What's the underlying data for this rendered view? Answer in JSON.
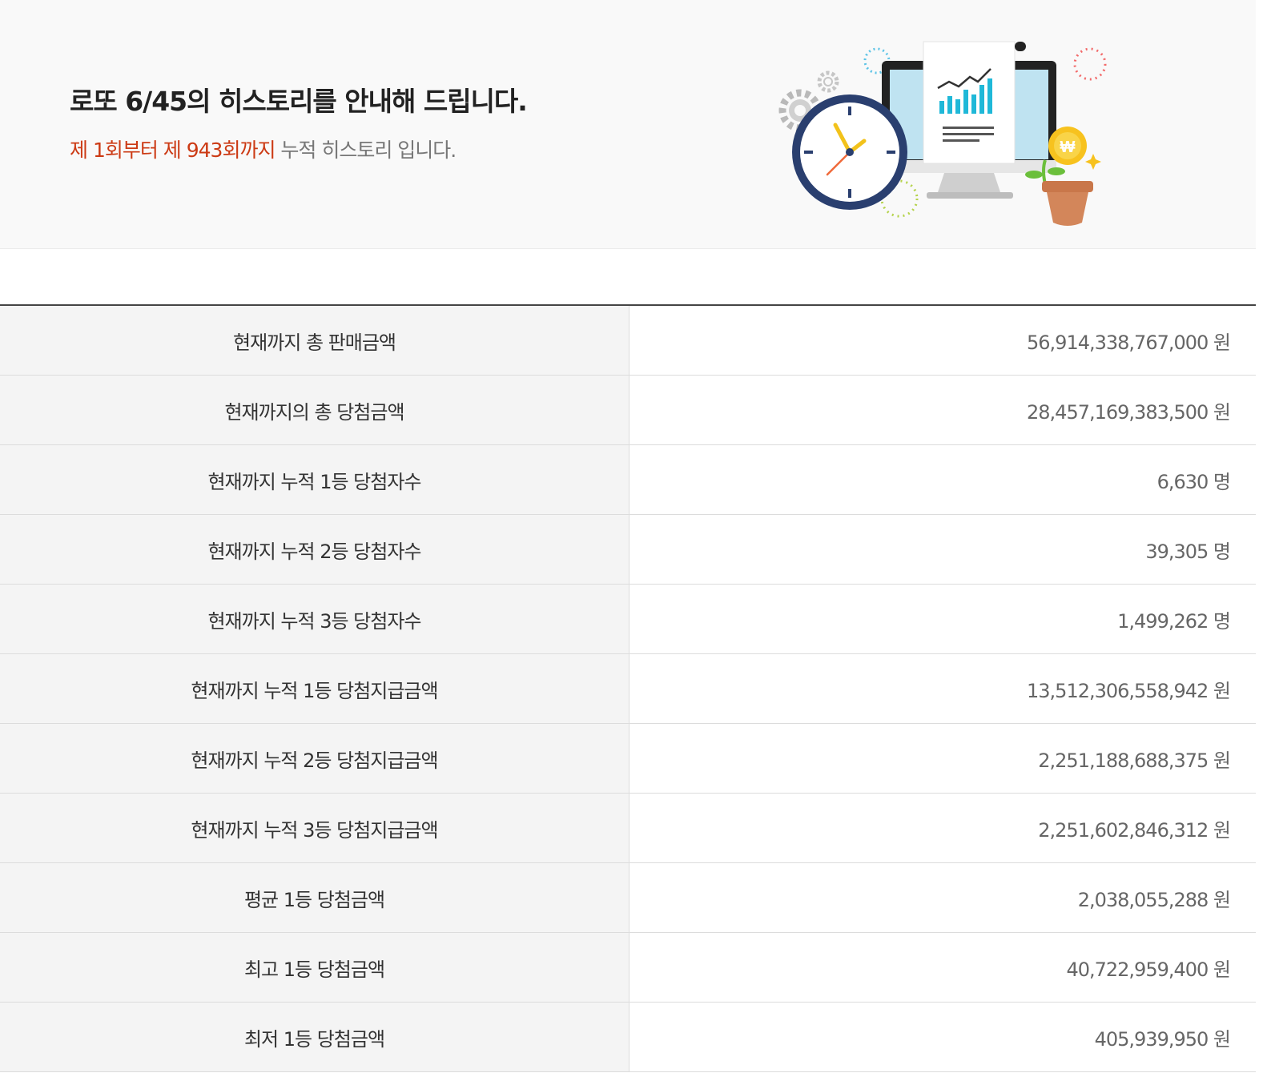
{
  "header": {
    "title": "로또 6/45의 히스토리를 안내해 드립니다.",
    "subtitle_highlight": "제 1회부터 제 943회까지",
    "subtitle_rest": " 누적 히스토리 입니다."
  },
  "illustration": {
    "icon": "lotto-history-illustration",
    "coin_symbol": "₩"
  },
  "stats": [
    {
      "label": "현재까지 총 판매금액",
      "value": "56,914,338,767,000 원"
    },
    {
      "label": "현재까지의 총 당첨금액",
      "value": "28,457,169,383,500 원"
    },
    {
      "label": "현재까지 누적 1등 당첨자수",
      "value": "6,630 명"
    },
    {
      "label": "현재까지 누적 2등 당첨자수",
      "value": "39,305 명"
    },
    {
      "label": "현재까지 누적 3등 당첨자수",
      "value": "1,499,262 명"
    },
    {
      "label": "현재까지 누적 1등 당첨지급금액",
      "value": "13,512,306,558,942 원"
    },
    {
      "label": "현재까지 누적 2등 당첨지급금액",
      "value": "2,251,188,688,375 원"
    },
    {
      "label": "현재까지 누적 3등 당첨지급금액",
      "value": "2,251,602,846,312 원"
    },
    {
      "label": "평균 1등 당첨금액",
      "value": "2,038,055,288 원"
    },
    {
      "label": "최고 1등 당첨금액",
      "value": "40,722,959,400 원"
    },
    {
      "label": "최저 1등 당첨금액",
      "value": "405,939,950 원"
    }
  ]
}
